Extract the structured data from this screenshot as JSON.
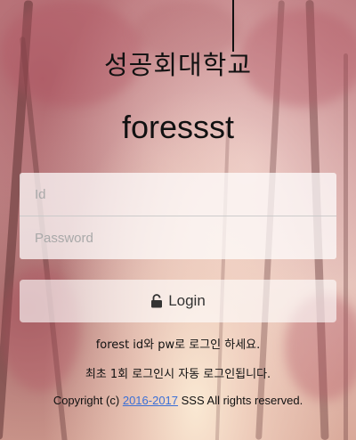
{
  "header": {
    "university_name": "성공회대학교",
    "app_title": "foressst"
  },
  "login_form": {
    "id_placeholder": "Id",
    "password_placeholder": "Password",
    "login_label": "Login",
    "login_icon": "lock-open-icon"
  },
  "messages": {
    "line1": "forest id와 pw로 로그인 하세요.",
    "line2": "최초 1회 로그인시 자동 로그인됩니다."
  },
  "footer": {
    "prefix": "Copyright (c) ",
    "years_link": "2016-2017",
    "suffix": " SSS All rights reserved."
  },
  "colors": {
    "link": "#3b6fd6",
    "text": "#111111"
  }
}
